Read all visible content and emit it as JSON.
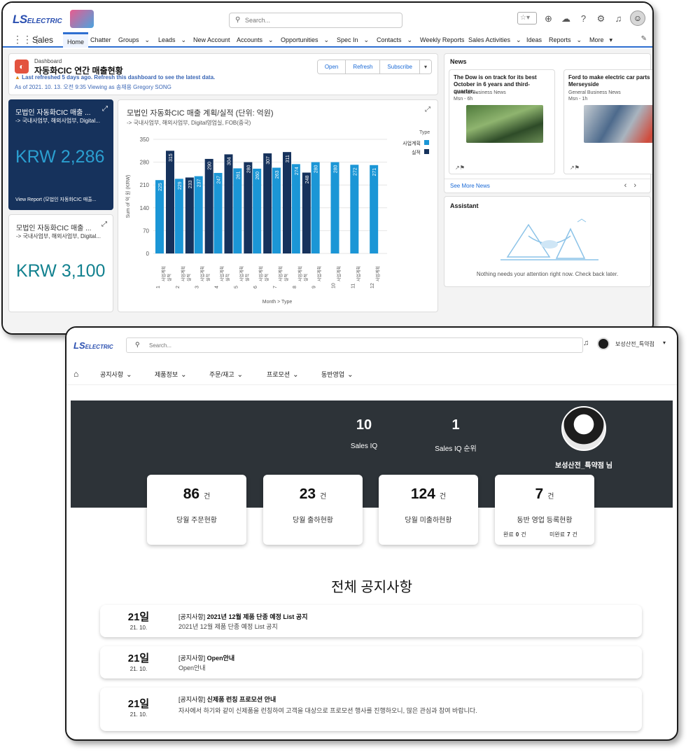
{
  "crm": {
    "logo": "LS ELECTRIC",
    "search_placeholder": "Search...",
    "app_name": "Sales",
    "nav": [
      "Home",
      "Chatter",
      "Groups",
      "Leads",
      "New Account",
      "Accounts",
      "Opportunities",
      "Spec In",
      "Contacts",
      "Weekly Reports",
      "Sales Activities",
      "Ideas",
      "Reports",
      "More"
    ],
    "dashboard": {
      "kicker": "Dashboard",
      "title": "자동화CIC 연간 매출현황",
      "warning": "Last refreshed 5 days ago. Refresh this dashboard to see the latest data.",
      "as_of": "As of 2021. 10. 13. 오전 9:35 Viewing as 송재용 Gregory SONG",
      "buttons": [
        "Open",
        "Refresh",
        "Subscribe"
      ]
    },
    "kpi1": {
      "title": "모법인 자동화CIC 매출 ...",
      "sub": "-> 국내사업부, 해외사업부, Digital...",
      "value": "KRW 2,286",
      "link": "View Report (모법인 자동화CIC 매출..."
    },
    "kpi2": {
      "title": "모법인 자동화CIC 매출 ...",
      "sub": "-> 국내사업부, 해외사업부, Digital...",
      "value": "KRW 3,100"
    },
    "news": {
      "heading": "News",
      "items": [
        {
          "title": "The Dow is on track for its best October in 6 years and third-quarter...",
          "source": "General Business News",
          "meta": "Msn - 6h"
        },
        {
          "title": "Ford to make electric car parts Merseyside",
          "source": "General Business News",
          "meta": "Msn - 1h"
        }
      ],
      "more": "See More News"
    },
    "assistant": {
      "heading": "Assistant",
      "message": "Nothing needs your attention right now. Check back later."
    }
  },
  "chart_data": {
    "type": "bar",
    "title": "모법인 자동화CIC 매출 계획/실적 (단위: 억원)",
    "subtitle": "-> 국내사업부, 해외사업부, Digital영업실, FOB(중국)",
    "categories": [
      "1",
      "2",
      "3",
      "4",
      "5",
      "6",
      "7",
      "8",
      "9",
      "10",
      "11",
      "12"
    ],
    "series": [
      {
        "name": "사업계획",
        "color": "#1b96d6",
        "values": [
          225,
          229,
          237,
          247,
          261,
          260,
          263,
          274,
          280,
          280,
          272,
          271
        ]
      },
      {
        "name": "실적",
        "color": "#16325c",
        "values": [
          315,
          233,
          290,
          304,
          280,
          307,
          311,
          248,
          null,
          null,
          null,
          null
        ]
      }
    ],
    "bar_labels": [
      [
        "사업계획",
        "실적"
      ],
      [
        "사업계획",
        "실적"
      ],
      [
        "사업계획",
        "실적"
      ],
      [
        "사업계획",
        "실적"
      ],
      [
        "사업계획",
        "실적"
      ],
      [
        "사업계획",
        "실적"
      ],
      [
        "사업계획",
        "실적"
      ],
      [
        "사업계획",
        "실적"
      ],
      [
        "사업계획"
      ],
      [
        "사업계획"
      ],
      [
        "사업계획"
      ],
      [
        "사업계획"
      ]
    ],
    "ylabel": "Sum of 억 원 (KRW)",
    "xlabel": "Month > Type",
    "legend_title": "Type",
    "yticks": [
      0,
      70,
      140,
      210,
      280,
      350
    ],
    "ylim": [
      0,
      350
    ],
    "legend_position": "right"
  },
  "portal": {
    "logo": "LS ELECTRIC",
    "search_placeholder": "Search...",
    "user": "보성산전_특약점",
    "nav": [
      "공지사항",
      "제품정보",
      "주문/재고",
      "프로모션",
      "동반영업"
    ],
    "sales_iq": {
      "value": "10",
      "label": "Sales IQ"
    },
    "sales_iq_rank": {
      "value": "1",
      "label": "Sales IQ 순위"
    },
    "profile_name": "보성산전_특약점 님",
    "unit": "건",
    "stats": [
      {
        "value": "86",
        "label": "당월 주문현황"
      },
      {
        "value": "23",
        "label": "당월 출하현황"
      },
      {
        "value": "124",
        "label": "당월 미출하현황"
      },
      {
        "value": "7",
        "label": "동반 영업 등록현황",
        "done_label": "완료",
        "done_value": "0",
        "pending_label": "미완료",
        "pending_value": "7"
      }
    ],
    "notices_title": "전체 공지사항",
    "notices": [
      {
        "day": "21일",
        "date": "21. 10.",
        "tag": "[공지사항]",
        "title": "2021년 12월 제품 단종 예정 List 공지",
        "body": "2021년 12월 제품 단종 예정 List 공지"
      },
      {
        "day": "21일",
        "date": "21. 10.",
        "tag": "[공지사항]",
        "title": "Open안내",
        "body": "Open안내"
      },
      {
        "day": "21일",
        "date": "21. 10.",
        "tag": "[공지사항]",
        "title": "신제품 런칭 프로모션 안내",
        "body": "자사에서 하기와 같이 신제품을 런칭하여 고객을 대상으로 프로모션 행사를 진행하오니, 많은 관심과 참여 바랍니다."
      }
    ]
  }
}
